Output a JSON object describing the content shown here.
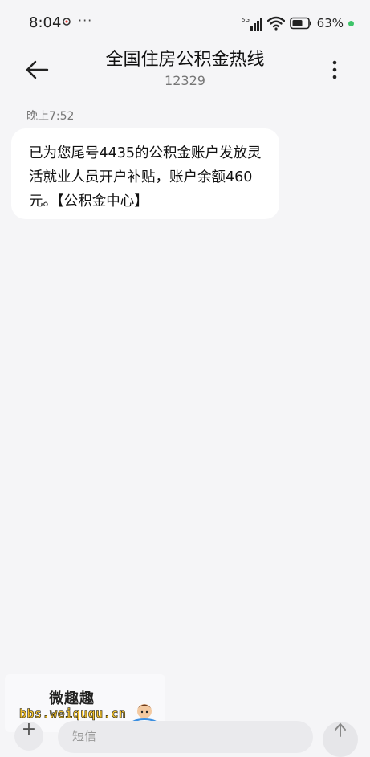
{
  "status_bar": {
    "time": "8:04",
    "dots": "···",
    "network": "5G",
    "battery_percent": "63%",
    "indicator_color": "#3fc46a"
  },
  "header": {
    "title": "全国住房公积金热线",
    "number": "12329"
  },
  "conversation": {
    "messages": [
      {
        "timestamp": "晚上7:52",
        "text": "已为您尾号4435的公积金账户发放灵活就业人员开户补贴，账户余额460元。【公积金中心】"
      }
    ]
  },
  "watermark": {
    "name": "微趣趣",
    "url": "bbs.weiququ.cn"
  },
  "composer": {
    "placeholder": "短信"
  },
  "icons": {
    "back": "arrow-left-icon",
    "menu": "more-vertical-icon",
    "signal": "signal-icon",
    "wifi": "wifi-icon",
    "battery": "battery-icon",
    "add": "plus-icon",
    "send": "send-icon"
  }
}
